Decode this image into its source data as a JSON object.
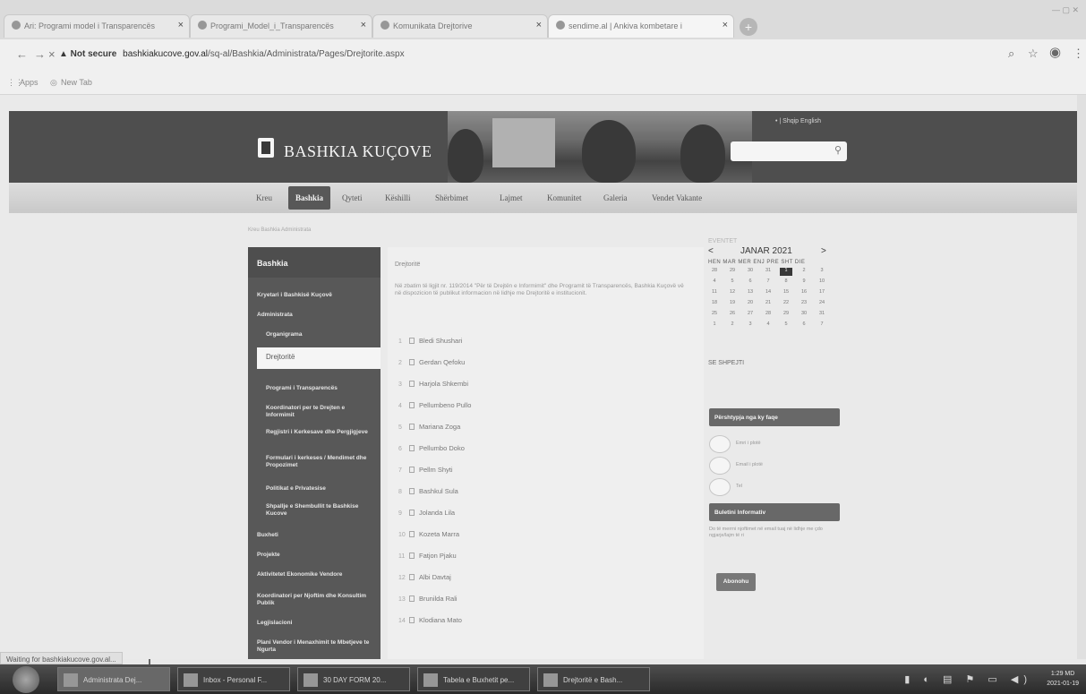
{
  "browser": {
    "tabs": [
      {
        "title": "Ari: Programi model i Transparencës"
      },
      {
        "title": "Programi_Model_i_Transparencës"
      },
      {
        "title": "Komunikata Drejtorive"
      },
      {
        "title": "sendime.al | Ankiva kombetare i"
      }
    ],
    "window_controls": "— ▢ ✕",
    "url_security": "▲ Not secure",
    "url_domain": "bashkiakucove.gov.al",
    "url_path": "/sq-al/Bashkia/Administrata/Pages/Drejtorite.aspx",
    "bookmarks": [
      "Apps",
      "New Tab"
    ]
  },
  "site": {
    "title": "BASHKIA KUÇOVE",
    "lang": "• | Shqip   English",
    "search_placeholder": ""
  },
  "nav": [
    "Kreu",
    "Bashkia",
    "Qyteti",
    "Këshilli",
    "Shërbimet",
    "Lajmet",
    "Komunitet",
    "Galeria",
    "Vendet Vakante"
  ],
  "breadcrumb": "Kreu  Bashkia  Administrata",
  "sidebar": {
    "title": "Bashkia",
    "items": [
      "Kryetari i Bashkisë Kuçovë",
      "Administrata",
      "Organigrama",
      "Drejtoritë",
      "Programi i Transparencës",
      "Koordinatori per te Drejten e Informimit",
      "Regjistri i Kerkesave dhe Pergjigjeve",
      "Formulari i kerkeses / Mendimet dhe Propozimet",
      "Politikat e Privatesise",
      "Shpallje e Shembullit te Bashkise Kucove",
      "Buxheti",
      "Projekte",
      "Aktivitetet Ekonomike Vendore",
      "Koordinatori per Njoftim dhe Konsultim Publik",
      "Legjislacioni",
      "Plani Vendor i Menaxhimit te Mbetjeve te Ngurta"
    ]
  },
  "content": {
    "title": "Drejtoritë",
    "intro": "Në zbatim të ligjit nr. 119/2014 \"Për të Drejtën e Informimit\" dhe Programit të Transparencës, Bashkia Kuçovë vë në dispozicion të publikut informacion në lidhje me Drejtoritë e institucionit.",
    "documents": [
      {
        "num": "1",
        "name": "Bledi Shushari"
      },
      {
        "num": "2",
        "name": "Gerdan Qefoku"
      },
      {
        "num": "3",
        "name": "Harjola Shkembi"
      },
      {
        "num": "4",
        "name": "Pellumbeno Pullo"
      },
      {
        "num": "5",
        "name": "Mariana Zoga"
      },
      {
        "num": "6",
        "name": "Pellumbo Doko"
      },
      {
        "num": "7",
        "name": "Pellm Shyti"
      },
      {
        "num": "8",
        "name": "Bashkul Sula"
      },
      {
        "num": "9",
        "name": "Jolanda Lila"
      },
      {
        "num": "10",
        "name": "Kozeta Marra"
      },
      {
        "num": "11",
        "name": "Fatjon Pjaku"
      },
      {
        "num": "12",
        "name": "Albi Davtaj"
      },
      {
        "num": "13",
        "name": "Brunilda Rali"
      },
      {
        "num": "14",
        "name": "Klodiana Mato"
      }
    ]
  },
  "calendar": {
    "label": "EVENTET",
    "month": "JANAR 2021",
    "prev": "<",
    "next": ">",
    "weekdays": "HEN MAR MER ENJ PRE SHT DIE",
    "weeks": [
      [
        "28",
        "29",
        "30",
        "31",
        "1",
        "2",
        "3"
      ],
      [
        "4",
        "5",
        "6",
        "7",
        "8",
        "9",
        "10"
      ],
      [
        "11",
        "12",
        "13",
        "14",
        "15",
        "16",
        "17"
      ],
      [
        "18",
        "19",
        "20",
        "21",
        "22",
        "23",
        "24"
      ],
      [
        "25",
        "26",
        "27",
        "28",
        "29",
        "30",
        "31"
      ],
      [
        "1",
        "2",
        "3",
        "4",
        "5",
        "6",
        "7"
      ]
    ],
    "today": "1",
    "all_link": "SE SHPEJTI"
  },
  "feedback": {
    "title": "Përshtypja nga ky faqe",
    "fields": [
      "Emri i plotë",
      "Email i plotë",
      "Tel"
    ]
  },
  "newsletter": {
    "title": "Buletini Informativ",
    "text": "Do të merrni njoftimet në email tuaj në lidhje me çdo ngjarje/lajm të ri",
    "button": "Abonohu"
  },
  "status": "Waiting for bashkiakucove.gov.al...",
  "taskbar": {
    "tasks": [
      "Administrata Dej...",
      "Inbox - Personal F...",
      "30 DAY FORM 20...",
      "Tabela e Buxhetit pe...",
      "Drejtoritë e Bash..."
    ],
    "tray": "▮ ◐ ▤ ⚑ ▭ ◀)",
    "clock_time": "1:29 MD",
    "clock_date": "2021-01-19"
  }
}
